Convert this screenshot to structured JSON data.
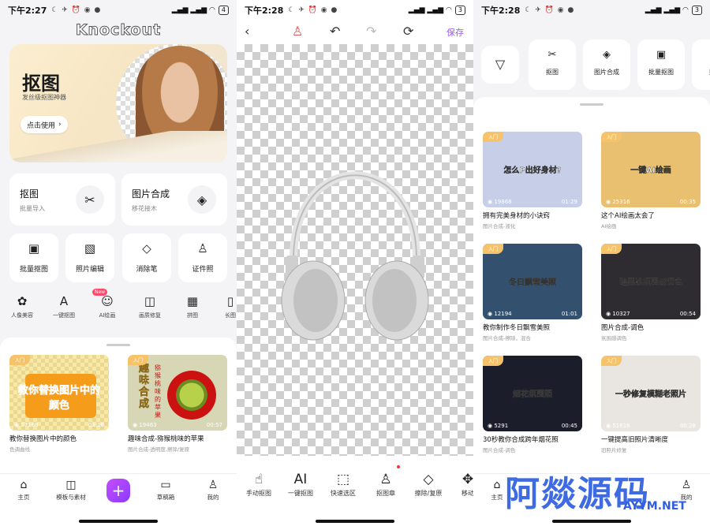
{
  "status": [
    {
      "time": "下午2:27",
      "battery": "4"
    },
    {
      "time": "下午2:28",
      "battery": "3"
    },
    {
      "time": "下午2:28",
      "battery": "3"
    }
  ],
  "home": {
    "app_title": "Knockout",
    "hero": {
      "title": "抠图",
      "subtitle": "发丝级抠图神器",
      "button": "点击使用"
    },
    "big_cards": [
      {
        "title": "抠图",
        "subtitle": "批量导入",
        "icon": "scissors-icon"
      },
      {
        "title": "图片合成",
        "subtitle": "移花接木",
        "icon": "layers-icon"
      }
    ],
    "small_cards": [
      {
        "label": "批量抠图",
        "icon": "batch-cutout-icon"
      },
      {
        "label": "照片编辑",
        "icon": "photo-edit-icon"
      },
      {
        "label": "消除笔",
        "icon": "eraser-icon"
      },
      {
        "label": "证件照",
        "icon": "id-photo-icon"
      }
    ],
    "tools": [
      {
        "label": "人像美容",
        "icon": "beauty-icon"
      },
      {
        "label": "一键抠图",
        "icon": "ai-cutout-icon"
      },
      {
        "label": "AI绘画",
        "icon": "robot-icon"
      },
      {
        "label": "画质修复",
        "icon": "quality-repair-icon"
      },
      {
        "label": "拼图",
        "icon": "collage-icon"
      },
      {
        "label": "长图",
        "icon": "long-image-icon"
      }
    ],
    "new_badge": "New",
    "videos": [
      {
        "badge": "入门",
        "views": "57168",
        "duration": "03:26",
        "title": "教你替换图片中的颜色",
        "sub": "色调曲线",
        "thumb_text": "教你替换图片中的颜色",
        "thumb_color": "#f2d24a"
      },
      {
        "badge": "入门",
        "views": "19463",
        "duration": "00:57",
        "title": "趣味合成-猕猴桃味的苹果",
        "sub": "图片合成-透明度,擦除/复原",
        "thumb_text": "趣味合成",
        "thumb_text2": "猕猴桃味的苹果",
        "thumb_color": "#d7d7b5"
      }
    ],
    "nav": [
      {
        "label": "主页",
        "icon": "home-icon"
      },
      {
        "label": "模板与素材",
        "icon": "template-icon"
      },
      {
        "label": "草稿箱",
        "icon": "drafts-icon"
      },
      {
        "label": "我的",
        "icon": "profile-icon"
      }
    ]
  },
  "editor": {
    "save": "保存",
    "tools": [
      {
        "label": "手动抠图",
        "icon": "hand-icon"
      },
      {
        "label": "一键抠图",
        "icon": "ai-icon"
      },
      {
        "label": "快速选区",
        "icon": "quick-select-icon"
      },
      {
        "label": "抠图章",
        "icon": "stamp-icon"
      },
      {
        "label": "擦除/复原",
        "icon": "eraser-icon"
      },
      {
        "label": "移动",
        "icon": "move-icon"
      }
    ]
  },
  "templates": {
    "chips": [
      {
        "label": "抠图",
        "icon": "scissors-icon"
      },
      {
        "label": "图片合成",
        "icon": "layers-icon"
      },
      {
        "label": "批量抠图",
        "icon": "batch-cutout-icon"
      },
      {
        "label": "照片",
        "icon": "photo-icon"
      }
    ],
    "videos": [
      {
        "badge": "入门",
        "views": "19868",
        "duration": "01:29",
        "title": "拥有完美身材的小诀窍",
        "sub": "图片合成-液化",
        "thumb_text": "怎么P出好身材?",
        "thumb_color": "#c7cfe8"
      },
      {
        "badge": "入门",
        "views": "25316",
        "duration": "00:35",
        "title": "这个AI绘画太会了",
        "sub": "AI绘画",
        "thumb_text": "一键AI绘画",
        "thumb_color": "#e8c070"
      },
      {
        "badge": "入门",
        "views": "12194",
        "duration": "01:01",
        "title": "教你制作冬日飘雪美照",
        "sub": "图片合成-擦除，混合",
        "thumb_text": "冬日飘雪美照",
        "thumb_color": "#33506e"
      },
      {
        "badge": "入门",
        "views": "10327",
        "duration": "00:54",
        "title": "图片合成-调色",
        "sub": "氛围感调色",
        "thumb_text": "暗黑系氛围感调色",
        "thumb_color": "#2e2c30"
      },
      {
        "badge": "入门",
        "views": "5291",
        "duration": "00:45",
        "title": "30秒教你合成跨年烟花照",
        "sub": "图片合成-调色",
        "thumb_text": "烟花氛围照",
        "thumb_color": "#1c1d2a"
      },
      {
        "badge": "入门",
        "views": "51616",
        "duration": "00:28",
        "title": "一键提高旧照片清晰度",
        "sub": "旧照片修复",
        "thumb_text": "一秒修复模糊老照片",
        "thumb_color": "#e9e6e2"
      }
    ],
    "nav_home": "主页",
    "nav_profile": "我的"
  },
  "watermark": {
    "text": "阿燚源码",
    "sub": "AYYM.NET"
  }
}
